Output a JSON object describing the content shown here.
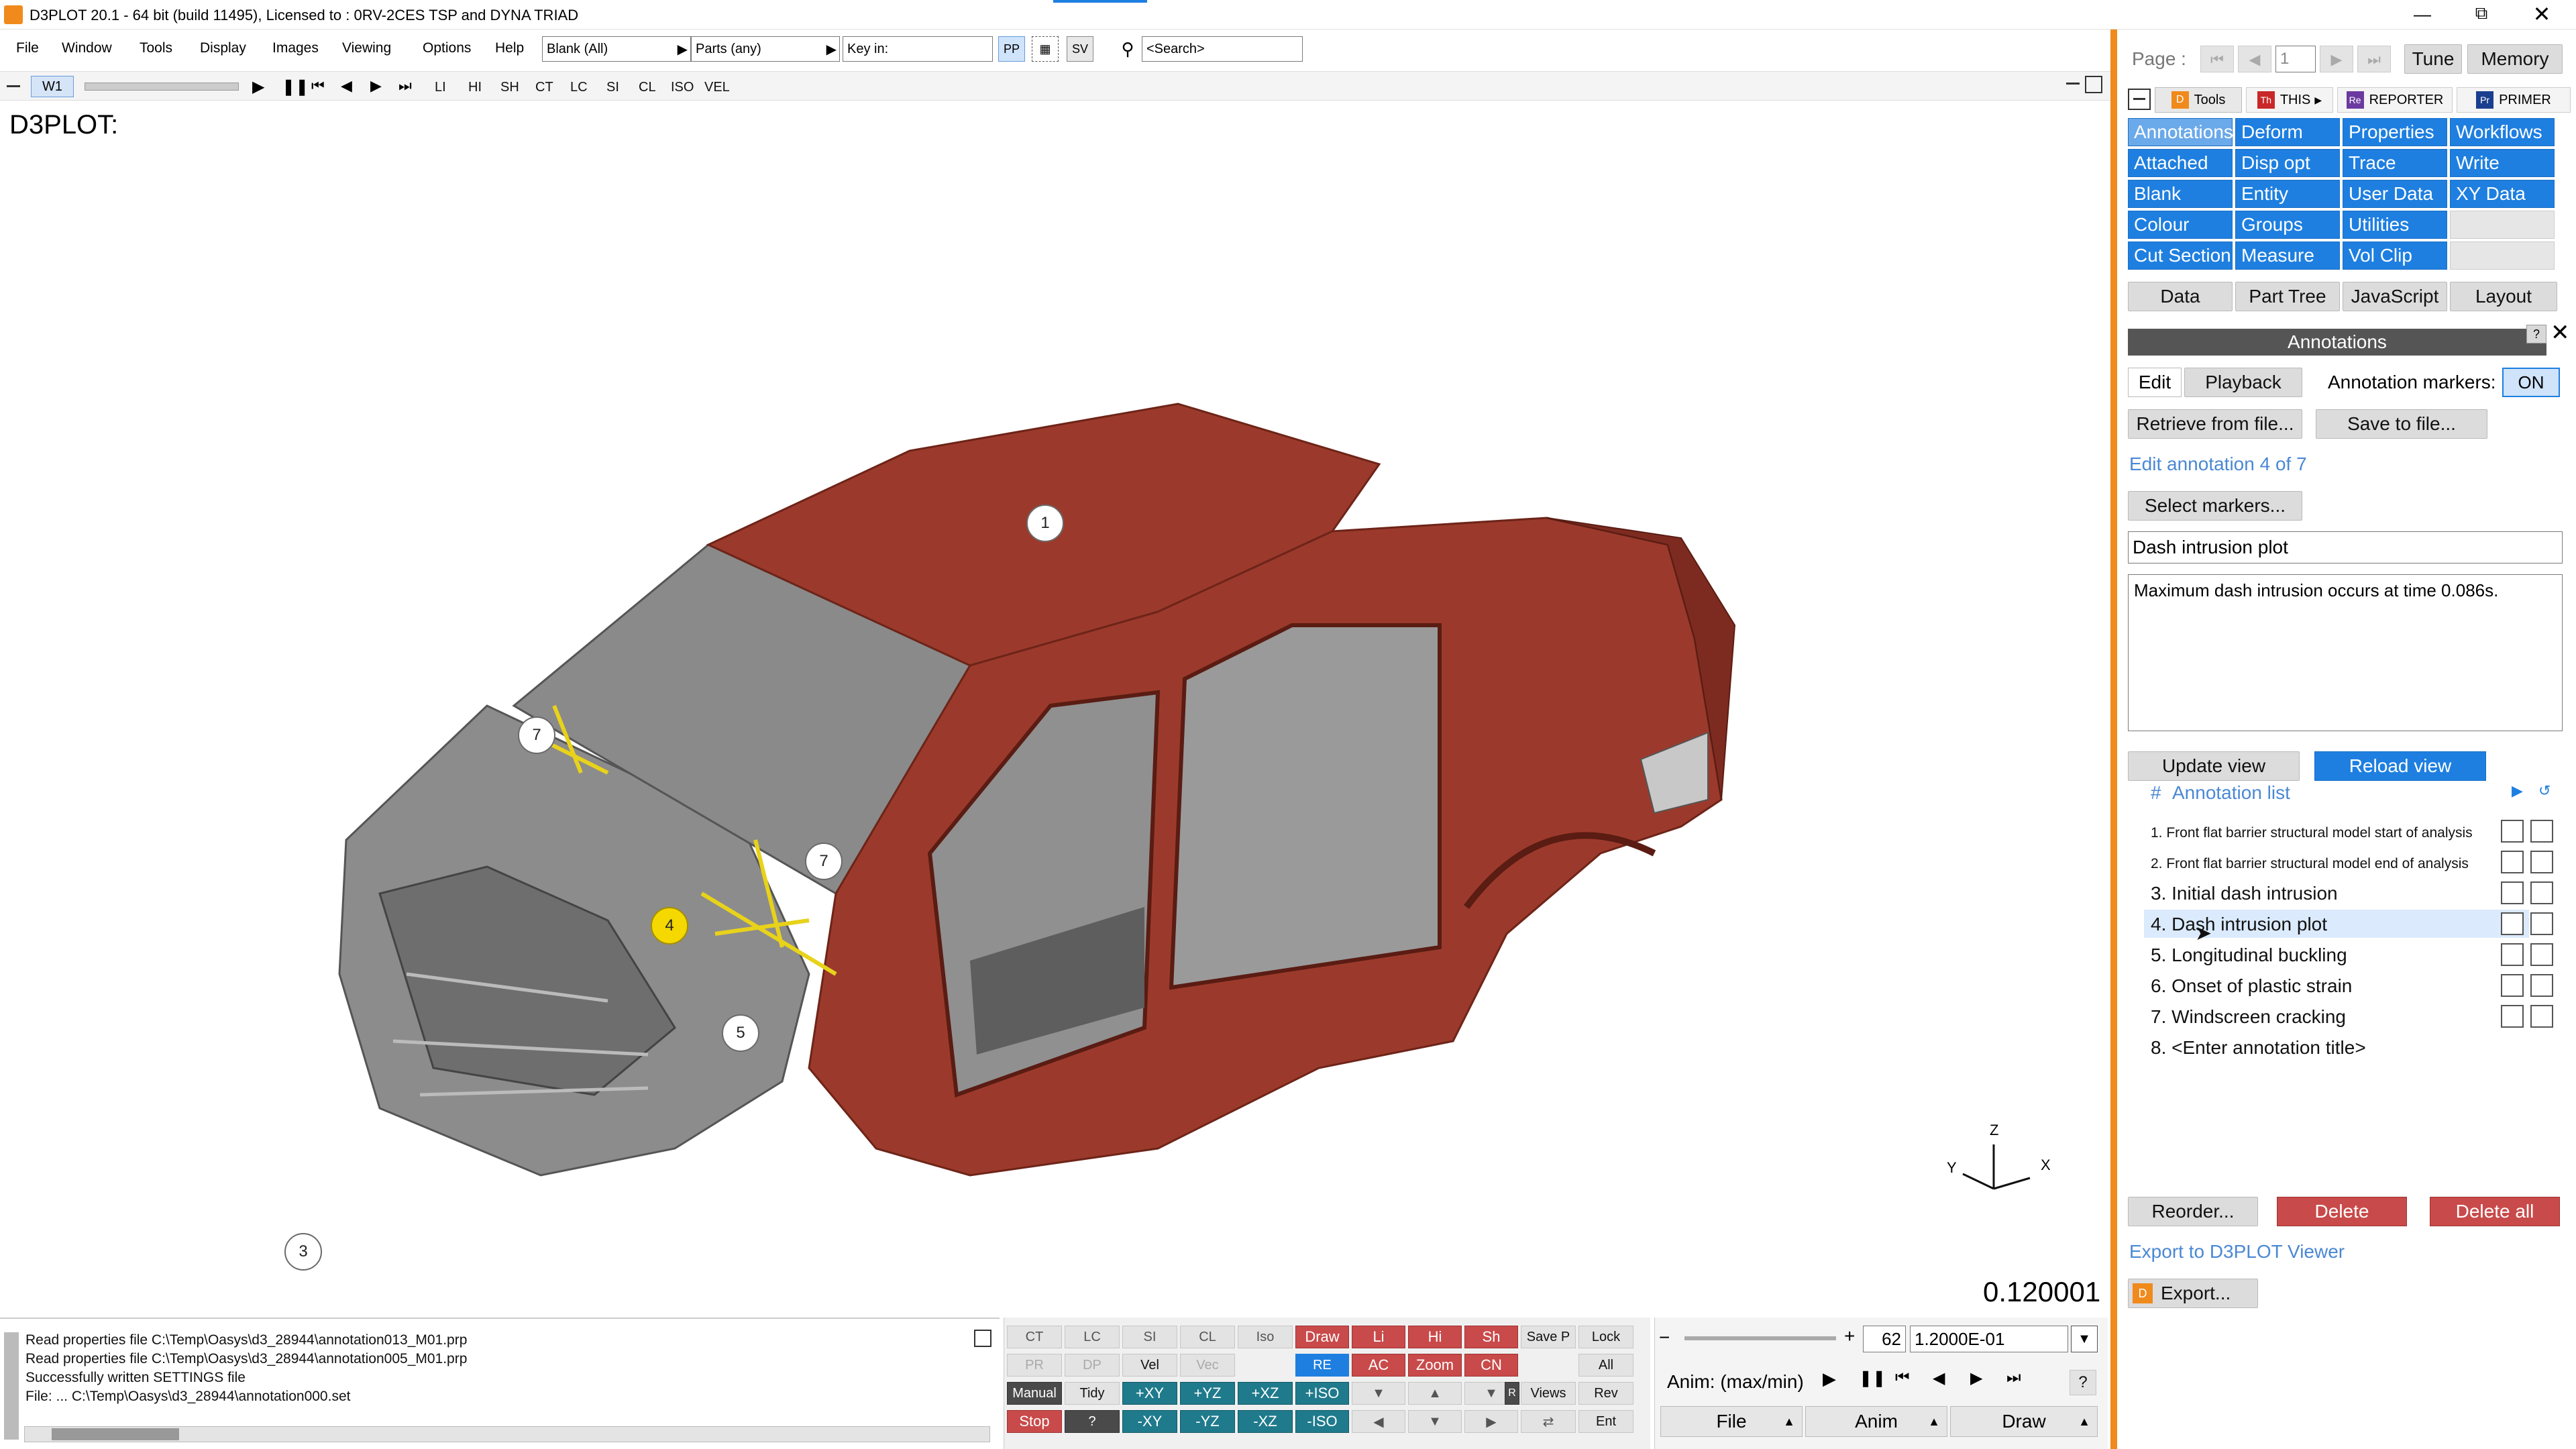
{
  "window": {
    "title": "D3PLOT 20.1 - 64 bit (build 11495), Licensed to : 0RV-2CES TSP and DYNA TRIAD"
  },
  "menu": [
    "File",
    "Window",
    "Tools",
    "Display",
    "Images",
    "Viewing",
    "Options",
    "Help"
  ],
  "toolbar": {
    "blank_select": "Blank (All)",
    "parts_select": "Parts (any)",
    "keyin_label": "Key in:",
    "pp": "PP",
    "sv": "SV",
    "search_placeholder": "<Search>"
  },
  "toolbar2": {
    "window_tab": "W1",
    "items": [
      "LI",
      "HI",
      "SH",
      "CT",
      "LC",
      "SI",
      "CL",
      "ISO",
      "VEL"
    ]
  },
  "viewport": {
    "label": "D3PLOT:",
    "time_value": "0.120001",
    "markers": [
      "1",
      "7",
      "7",
      "4",
      "5",
      "3"
    ],
    "axes": {
      "z": "Z",
      "y": "Y",
      "x": "X"
    }
  },
  "log": {
    "lines": [
      "Read properties file C:\\Temp\\Oasys\\d3_28944\\annotation013_M01.prp",
      "Read properties file C:\\Temp\\Oasys\\d3_28944\\annotation005_M01.prp",
      "Successfully written SETTINGS file",
      "File: ... C:\\Temp\\Oasys\\d3_28944\\annotation000.set"
    ]
  },
  "bottom_controls": {
    "row1": [
      "CT",
      "LC",
      "SI",
      "CL",
      "Iso",
      "Draw",
      "Li",
      "Hi",
      "Sh",
      "Save P",
      "Lock"
    ],
    "row2": [
      "PR",
      "DP",
      "Vel",
      "Vec",
      "RE",
      "AC",
      "Zoom",
      "CN",
      "All"
    ],
    "row3": [
      "Manual",
      "Tidy",
      "+XY",
      "+YZ",
      "+XZ",
      "+ISO",
      "Views",
      "Rev"
    ],
    "row4": [
      "Stop",
      "?",
      "-XY",
      "-YZ",
      "-XZ",
      "-ISO",
      "Ent"
    ],
    "r_label": "R"
  },
  "anim_panel": {
    "state_number": "62",
    "time_field": "1.2000E-01",
    "anim_label": "Anim: (max/min)",
    "help": "?",
    "bottom_tabs": [
      "File",
      "Anim",
      "Draw"
    ]
  },
  "right_panel": {
    "page_label": "Page :",
    "page_field": "1",
    "tune": "Tune",
    "memory": "Memory",
    "tabs": [
      "Tools",
      "THIS",
      "REPORTER",
      "PRIMER"
    ],
    "tool_buttons": [
      [
        "Annotations",
        "Deform",
        "Properties",
        "Workflows"
      ],
      [
        "Attached",
        "Disp opt",
        "Trace",
        "Write"
      ],
      [
        "Blank",
        "Entity",
        "User Data",
        "XY Data"
      ],
      [
        "Colour",
        "Groups",
        "Utilities",
        ""
      ],
      [
        "Cut Section",
        "Measure",
        "Vol Clip",
        ""
      ]
    ],
    "sub_tabs": [
      "Data",
      "Part Tree",
      "JavaScript",
      "Layout"
    ],
    "annotations_title": "Annotations",
    "edit_tab": "Edit",
    "playback_tab": "Playback",
    "markers_label": "Annotation markers:",
    "markers_state": "ON",
    "retrieve": "Retrieve from file...",
    "save": "Save to file...",
    "edit_status": "Edit annotation 4 of 7",
    "select_markers": "Select markers...",
    "annotation_title_value": "Dash intrusion plot",
    "annotation_text_value": "Maximum dash intrusion occurs at time 0.086s.",
    "update_view": "Update view",
    "reload_view": "Reload view",
    "list_header_hash": "#",
    "list_header": "Annotation list",
    "annotation_list": [
      "1.  Front flat barrier structural model start of analysis",
      "2.  Front flat barrier structural model end of analysis",
      "3.  Initial dash intrusion",
      "4.  Dash intrusion plot",
      "5.  Longitudinal buckling",
      "6.  Onset of plastic strain",
      "7.  Windscreen cracking",
      "8.  <Enter annotation title>"
    ],
    "reorder": "Reorder...",
    "delete": "Delete",
    "delete_all": "Delete all",
    "export_link": "Export to D3PLOT Viewer",
    "export": "Export..."
  },
  "colors": {
    "accent_blue": "#1e7fe0",
    "car_red": "#9b3a2c",
    "panel_border_orange": "#f08a1c",
    "delete_red": "#c94a4a",
    "teal": "#1f7a8c"
  }
}
